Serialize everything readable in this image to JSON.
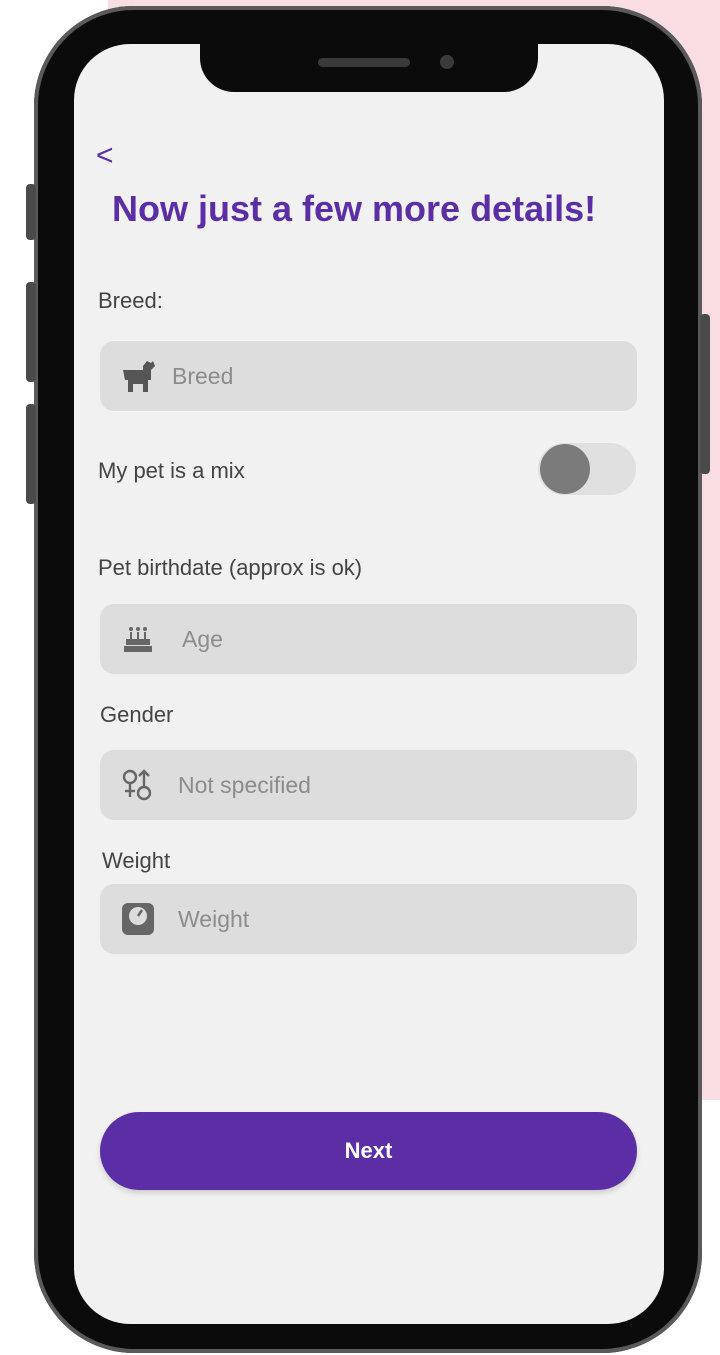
{
  "header": {
    "back_glyph": "<",
    "title": "Now just a few more details!"
  },
  "form": {
    "breed": {
      "label": "Breed:",
      "placeholder": "Breed",
      "icon": "dog-icon"
    },
    "mix": {
      "label": "My pet is a mix",
      "enabled": false
    },
    "birthdate": {
      "label": "Pet birthdate (approx is ok)",
      "placeholder": "Age",
      "icon": "cake-icon"
    },
    "gender": {
      "label": "Gender",
      "placeholder": "Not specified",
      "icon": "gender-icon"
    },
    "weight": {
      "label": "Weight",
      "placeholder": "Weight",
      "icon": "scale-icon"
    }
  },
  "actions": {
    "next_label": "Next"
  },
  "colors": {
    "accent": "#5b2ea6",
    "screen_bg": "#f1f1f1",
    "field_bg": "#dddddd",
    "page_bg_pink": "#f9dde3"
  }
}
